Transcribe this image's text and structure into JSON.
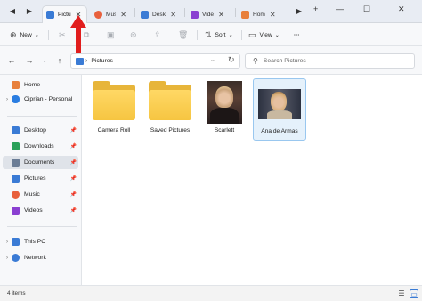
{
  "tabs": [
    {
      "label": "Pictu",
      "icon": "pictures-icon",
      "color": "#3a7bd5",
      "active": true
    },
    {
      "label": "Mus",
      "icon": "music-icon",
      "color": "#e8603c",
      "active": false
    },
    {
      "label": "Deskt",
      "icon": "desktop-icon",
      "color": "#3a7bd5",
      "active": false
    },
    {
      "label": "Vide",
      "icon": "videos-icon",
      "color": "#8a3fd1",
      "active": false
    },
    {
      "label": "Hom",
      "icon": "home-icon",
      "color": "#e8803c",
      "active": false
    }
  ],
  "commands": {
    "new_label": "New",
    "sort_label": "Sort",
    "view_label": "View",
    "more_label": "···"
  },
  "address": {
    "path": "Pictures",
    "search_placeholder": "Search Pictures"
  },
  "sidebar": {
    "items": [
      {
        "label": "Home",
        "icon": "home-icon",
        "color": "#e8803c"
      },
      {
        "label": "Ciprian - Personal",
        "icon": "onedrive-icon",
        "color": "#2a7de1"
      },
      {
        "label": "Desktop",
        "icon": "desktop-icon",
        "color": "#3a7bd5"
      },
      {
        "label": "Downloads",
        "icon": "downloads-icon",
        "color": "#2aa15a"
      },
      {
        "label": "Documents",
        "icon": "documents-icon",
        "color": "#6b7d96"
      },
      {
        "label": "Pictures",
        "icon": "pictures-icon",
        "color": "#3a7bd5"
      },
      {
        "label": "Music",
        "icon": "music-icon",
        "color": "#e8603c"
      },
      {
        "label": "Videos",
        "icon": "videos-icon",
        "color": "#8a3fd1"
      },
      {
        "label": "This PC",
        "icon": "this-pc-icon",
        "color": "#3a7bd5"
      },
      {
        "label": "Network",
        "icon": "network-icon",
        "color": "#3a7bd5"
      }
    ]
  },
  "files": [
    {
      "name": "Camera Roll",
      "type": "folder"
    },
    {
      "name": "Saved Pictures",
      "type": "folder"
    },
    {
      "name": "Scarlett",
      "type": "photo"
    },
    {
      "name": "Ana de Armas",
      "type": "photo"
    }
  ],
  "status": {
    "item_count": "4 items"
  }
}
